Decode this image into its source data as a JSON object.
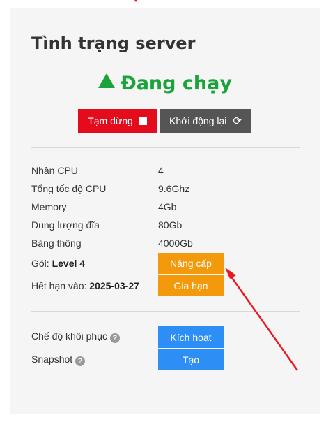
{
  "server": {
    "title": "Tình trạng server",
    "status": "Đang chạy",
    "pause_label": "Tạm dừng",
    "restart_label": "Khởi động lại"
  },
  "specs": [
    {
      "label": "Nhân CPU",
      "value": "4"
    },
    {
      "label": "Tổng tốc độ CPU",
      "value": "9.6Ghz"
    },
    {
      "label": "Memory",
      "value": "4Gb"
    },
    {
      "label": "Dung lượng đĩa",
      "value": "80Gb"
    },
    {
      "label": "Băng thông",
      "value": "4000Gb"
    }
  ],
  "plan": {
    "label": "Gói:",
    "value": "Level 4",
    "upgrade_label": "Nâng cấp"
  },
  "expiry": {
    "label": "Hết hạn vào:",
    "value": "2025-03-27",
    "renew_label": "Gia hạn"
  },
  "restore": {
    "label": "Chế độ khôi phục",
    "button_label": "Kích hoạt"
  },
  "snapshot": {
    "label": "Snapshot",
    "button_label": "Tạo"
  },
  "icons": {
    "status": "triangle-up-icon",
    "pause": "stop-square-icon",
    "restart": "refresh-icon",
    "help": "question-circle-icon"
  },
  "colors": {
    "running": "#1aa33b",
    "pause": "#e30b1c",
    "restart": "#555555",
    "upgrade": "#f39a0c",
    "action": "#2d8ef5",
    "annotation": "#e8191e"
  }
}
